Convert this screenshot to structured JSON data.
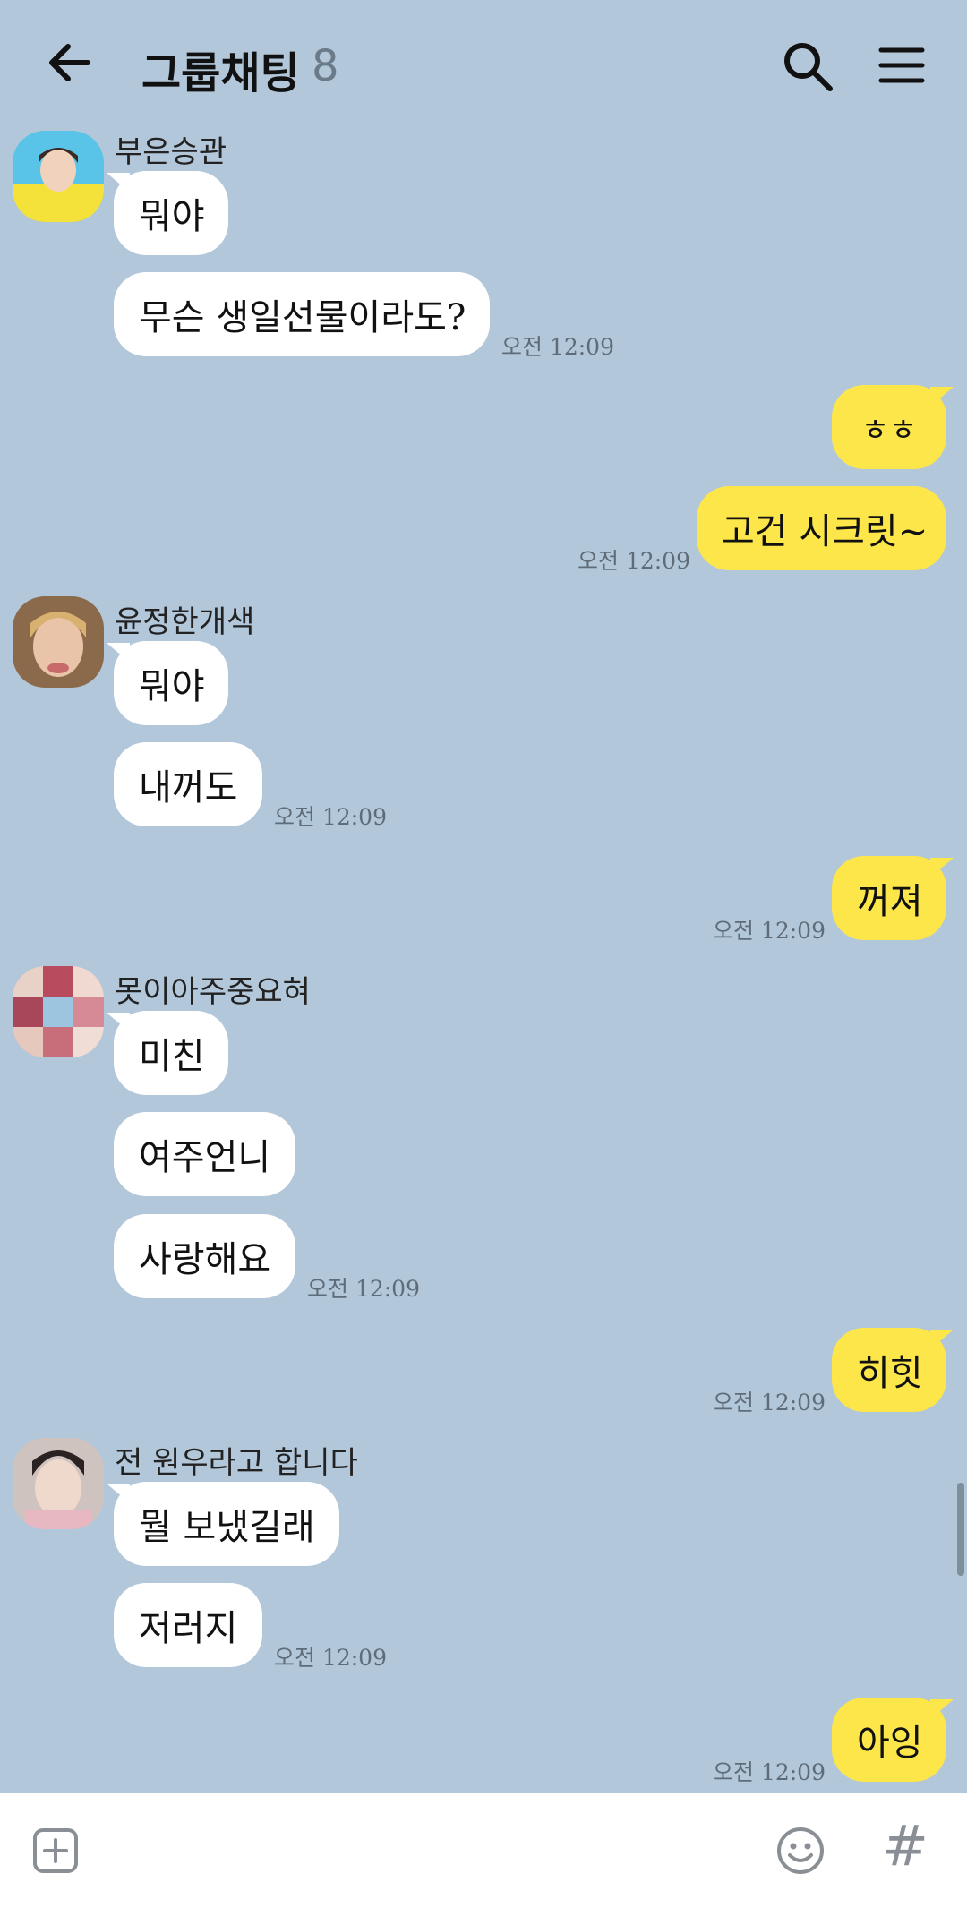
{
  "header": {
    "title": "그룹채팅",
    "member_count": "8",
    "back_icon": "back-arrow-icon",
    "search_icon": "search-icon",
    "menu_icon": "hamburger-menu-icon"
  },
  "messages": {
    "m1": {
      "sender": "부은승관",
      "lines": [
        "뭐야",
        "무슨 생일선물이라도?"
      ],
      "time": "오전 12:09"
    },
    "m2": {
      "lines": [
        "ㅎㅎ",
        "고건 시크릿~"
      ],
      "time": "오전 12:09"
    },
    "m3": {
      "sender": "윤정한개색",
      "lines": [
        "뭐야",
        "내꺼도"
      ],
      "time": "오전 12:09"
    },
    "m4": {
      "lines": [
        "꺼져"
      ],
      "time": "오전 12:09"
    },
    "m5": {
      "sender": "못이아주중요혀",
      "lines": [
        "미친",
        "여주언니",
        "사랑해요"
      ],
      "time": "오전 12:09"
    },
    "m6": {
      "lines": [
        "히힛"
      ],
      "time": "오전 12:09"
    },
    "m7": {
      "sender": "전 원우라고 합니다",
      "lines": [
        "뭘 보냈길래",
        "저러지"
      ],
      "time": "오전 12:09"
    },
    "m8": {
      "lines": [
        "아잉"
      ],
      "time": "오전 12:09"
    }
  },
  "input_bar": {
    "plus_icon": "add-attachment-icon",
    "emoji_icon": "emoji-icon",
    "hash": "#"
  },
  "colors": {
    "background": "#b2c7da",
    "incoming_bubble": "#ffffff",
    "outgoing_bubble": "#fce64a"
  }
}
